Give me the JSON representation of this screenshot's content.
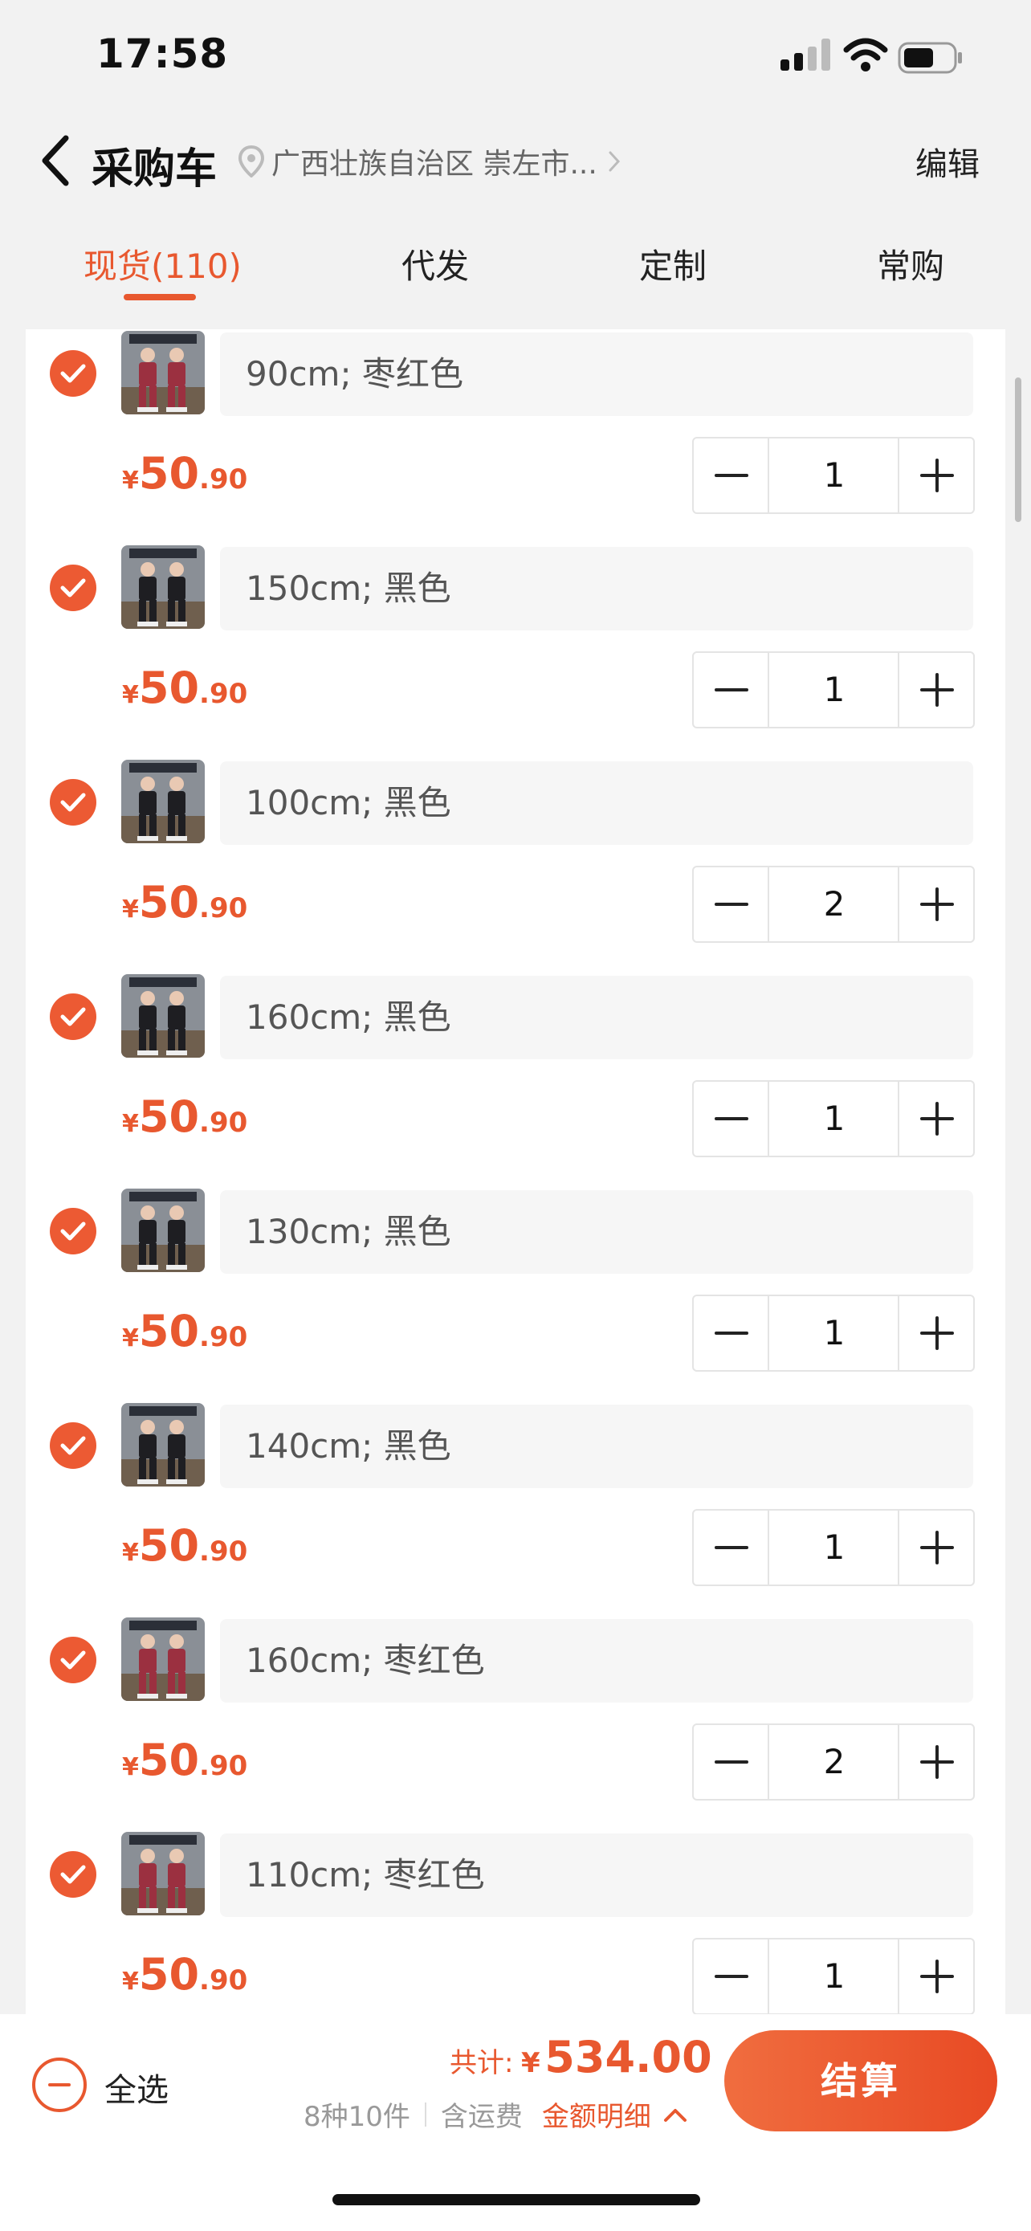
{
  "status_bar": {
    "time": "17:58",
    "signal_icon": "cellular-signal-icon",
    "wifi_icon": "wifi-icon",
    "battery_icon": "battery-icon"
  },
  "header": {
    "title": "采购车",
    "location": "广西壮族自治区 崇左市...",
    "edit_label": "编辑"
  },
  "tabs": [
    {
      "label": "现货(110)",
      "active": true
    },
    {
      "label": "代发",
      "active": false
    },
    {
      "label": "定制",
      "active": false
    },
    {
      "label": "常购",
      "active": false
    }
  ],
  "items": [
    {
      "spec": "90cm; 枣红色",
      "price_currency": "¥",
      "price_int": "50",
      "price_dec": ".90",
      "qty": "1",
      "checked": true,
      "thumb_color": "maroon"
    },
    {
      "spec": "150cm; 黑色",
      "price_currency": "¥",
      "price_int": "50",
      "price_dec": ".90",
      "qty": "1",
      "checked": true,
      "thumb_color": "black"
    },
    {
      "spec": "100cm; 黑色",
      "price_currency": "¥",
      "price_int": "50",
      "price_dec": ".90",
      "qty": "2",
      "checked": true,
      "thumb_color": "black"
    },
    {
      "spec": "160cm; 黑色",
      "price_currency": "¥",
      "price_int": "50",
      "price_dec": ".90",
      "qty": "1",
      "checked": true,
      "thumb_color": "black"
    },
    {
      "spec": "130cm; 黑色",
      "price_currency": "¥",
      "price_int": "50",
      "price_dec": ".90",
      "qty": "1",
      "checked": true,
      "thumb_color": "black"
    },
    {
      "spec": "140cm; 黑色",
      "price_currency": "¥",
      "price_int": "50",
      "price_dec": ".90",
      "qty": "1",
      "checked": true,
      "thumb_color": "black"
    },
    {
      "spec": "160cm; 枣红色",
      "price_currency": "¥",
      "price_int": "50",
      "price_dec": ".90",
      "qty": "2",
      "checked": true,
      "thumb_color": "maroon"
    },
    {
      "spec": "110cm; 枣红色",
      "price_currency": "¥",
      "price_int": "50",
      "price_dec": ".90",
      "qty": "1",
      "checked": true,
      "thumb_color": "maroon"
    }
  ],
  "bottom": {
    "select_all_label": "全选",
    "total_label": "共计:",
    "total_currency": "¥",
    "total_value": "534.00",
    "count_text": "8种10件",
    "shipping_text": "含运费",
    "detail_label": "金额明细",
    "checkout_label": "结算"
  },
  "colors": {
    "accent": "#e8582f",
    "check": "#ec5a33",
    "background": "#f2f2f2"
  }
}
